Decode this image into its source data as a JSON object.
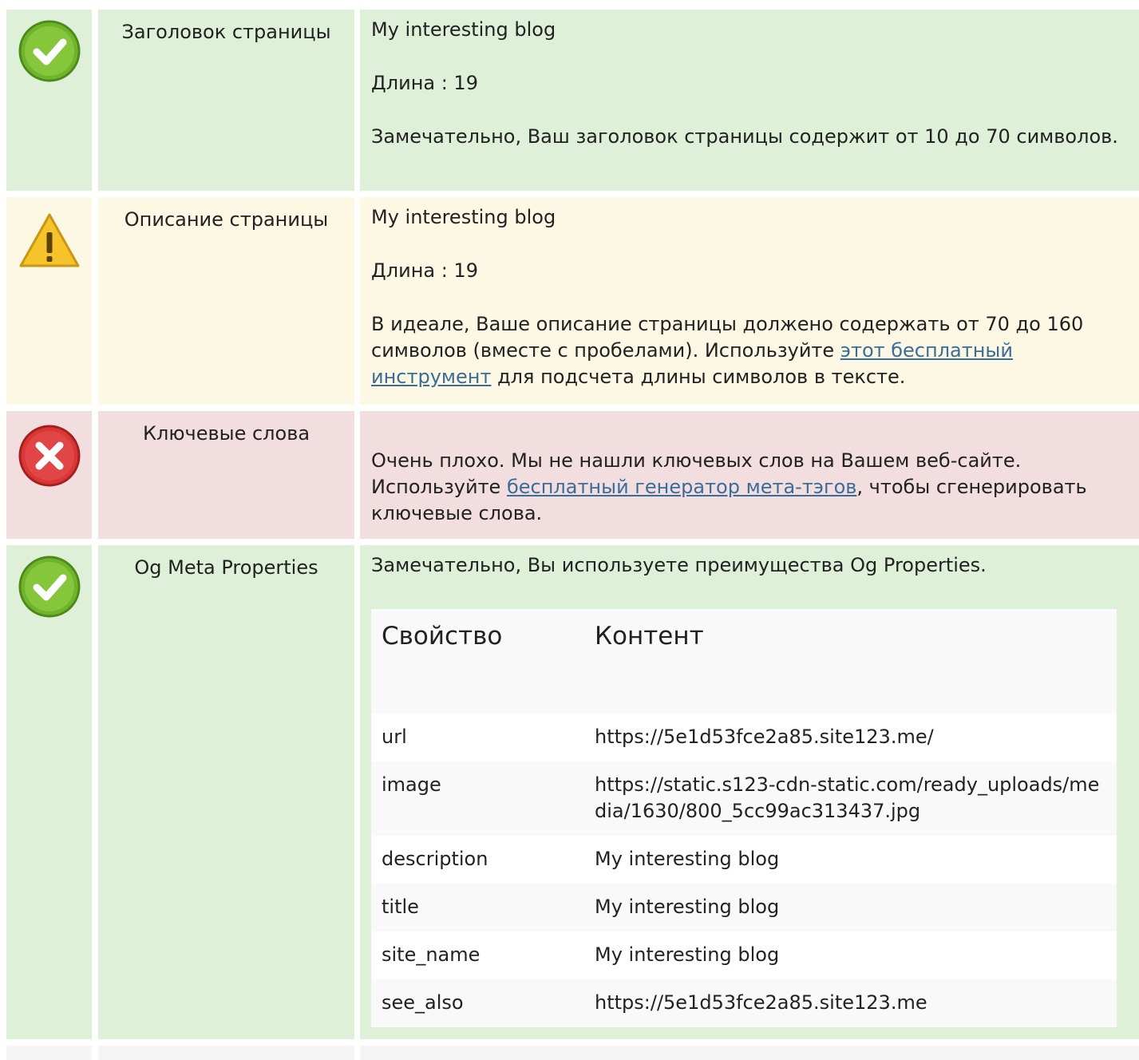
{
  "title_row": {
    "label": "Заголовок страницы",
    "value": "My interesting blog",
    "length": "Длина : 19",
    "message": "Замечательно, Ваш заголовок страницы содержит от 10 до 70 символов."
  },
  "description_row": {
    "label": "Описание страницы",
    "value": "My interesting blog",
    "length": "Длина : 19",
    "message_before": "В идеале, Ваше описание страницы должено содержать от 70 до 160 символов (вместе с пробелами). Используйте ",
    "link": "этот бесплатный инструмент",
    "message_after": " для подсчета длины символов в тексте."
  },
  "keywords_row": {
    "label": "Ключевые слова",
    "message_before": "Очень плохо. Мы не нашли ключевых слов на Вашем веб-сайте. Используйте ",
    "link": "бесплатный генератор мета-тэгов",
    "message_after": ", чтобы сгенерировать ключевые слова."
  },
  "og_row": {
    "label": "Og Meta Properties",
    "message": "Замечательно, Вы используете преимущества Og Properties.",
    "headers": [
      "Свойство",
      "Контент"
    ],
    "rows": [
      [
        "url",
        "https://5e1d53fce2a85.site123.me/"
      ],
      [
        "image",
        "https://static.s123-cdn-static.com/ready_uploads/media/1630/800_5cc99ac313437.jpg"
      ],
      [
        "description",
        "My interesting blog"
      ],
      [
        "title",
        "My interesting blog"
      ],
      [
        "site_name",
        "My interesting blog"
      ],
      [
        "see_also",
        "https://5e1d53fce2a85.site123.me"
      ]
    ]
  },
  "icons": {
    "good": "check-circle-icon",
    "warn": "warning-triangle-icon",
    "bad": "error-cross-icon"
  },
  "colors": {
    "good_bg": "#dff0d8",
    "warn_bg": "#fcf8e3",
    "bad_bg": "#f2dede",
    "link": "#3a6d99"
  }
}
